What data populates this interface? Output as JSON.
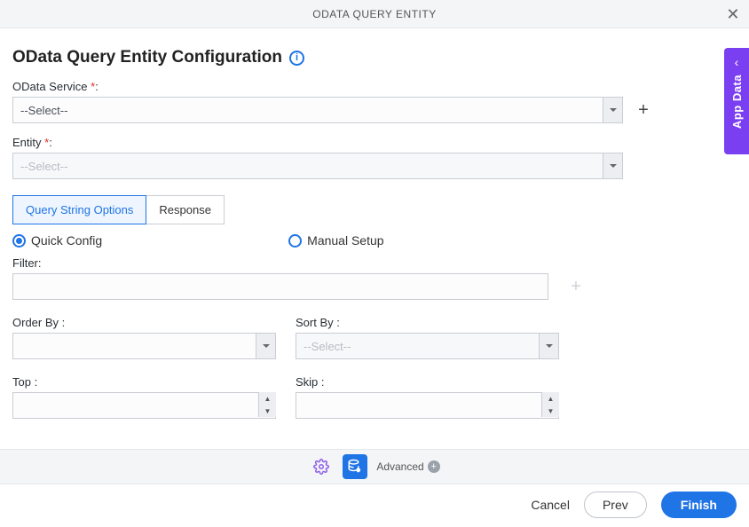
{
  "titlebar": {
    "title": "ODATA QUERY ENTITY"
  },
  "page": {
    "heading": "OData Query Entity Configuration"
  },
  "fields": {
    "odata_service": {
      "label": "OData Service",
      "value": "--Select--",
      "required": "*"
    },
    "entity": {
      "label": "Entity",
      "value": "--Select--",
      "required": "*"
    },
    "filter": {
      "label": "Filter:"
    },
    "order_by": {
      "label": "Order By :"
    },
    "sort_by": {
      "label": "Sort By :",
      "placeholder": "--Select--"
    },
    "top": {
      "label": "Top :"
    },
    "skip": {
      "label": "Skip :"
    }
  },
  "tabs": {
    "query": "Query String Options",
    "response": "Response"
  },
  "radios": {
    "quick": "Quick Config",
    "manual": "Manual Setup"
  },
  "toolbar": {
    "advanced": "Advanced"
  },
  "footer": {
    "cancel": "Cancel",
    "prev": "Prev",
    "finish": "Finish"
  },
  "side": {
    "label": "App Data"
  },
  "colors": {
    "primary": "#1f74e6",
    "accent": "#7b3ff2"
  }
}
